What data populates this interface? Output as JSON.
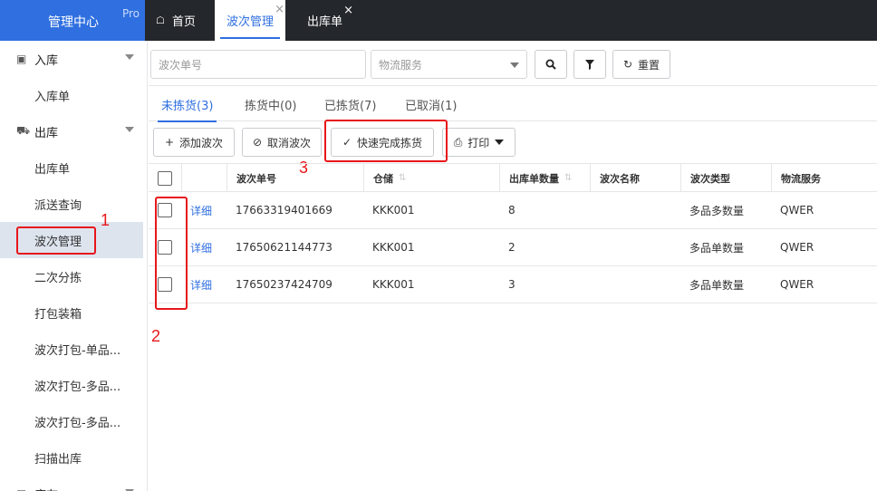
{
  "brand": {
    "title": "管理中心",
    "pro": "Pro"
  },
  "tabs": {
    "home": "首页",
    "active": "波次管理",
    "outbound": "出库单",
    "close": "×"
  },
  "sidebar": {
    "inbound": {
      "label": "入库",
      "items": [
        "入库单"
      ]
    },
    "outbound": {
      "label": "出库",
      "items": [
        "出库单",
        "派送查询",
        "波次管理",
        "二次分拣",
        "打包装箱",
        "波次打包-单品...",
        "波次打包-多品...",
        "波次打包-多品...",
        "扫描出库"
      ]
    },
    "inventory": {
      "label": "库存"
    }
  },
  "search": {
    "wave_placeholder": "波次单号",
    "logistics_placeholder": "物流服务",
    "reset": "重置"
  },
  "subtabs": [
    "未拣货(3)",
    "拣货中(0)",
    "已拣货(7)",
    "已取消(1)"
  ],
  "toolbar": {
    "add": "添加波次",
    "cancel": "取消波次",
    "quick": "快速完成拣货",
    "print": "打印"
  },
  "annotations": [
    "1",
    "2",
    "3"
  ],
  "table": {
    "columns": [
      "波次单号",
      "仓储",
      "出库单数量",
      "波次名称",
      "波次类型",
      "物流服务"
    ],
    "detail_label": "详细",
    "rows": [
      {
        "wave_no": "17663319401669",
        "warehouse": "KKK001",
        "count": "8",
        "name": "",
        "type": "多品多数量",
        "logistics": "QWER"
      },
      {
        "wave_no": "17650621144773",
        "warehouse": "KKK001",
        "count": "2",
        "name": "",
        "type": "多品单数量",
        "logistics": "QWER"
      },
      {
        "wave_no": "17650237424709",
        "warehouse": "KKK001",
        "count": "3",
        "name": "",
        "type": "多品单数量",
        "logistics": "QWER"
      }
    ]
  },
  "colors": {
    "primary": "#2f6fe0",
    "topbar": "#24272b",
    "annotation": "#e8161b"
  }
}
